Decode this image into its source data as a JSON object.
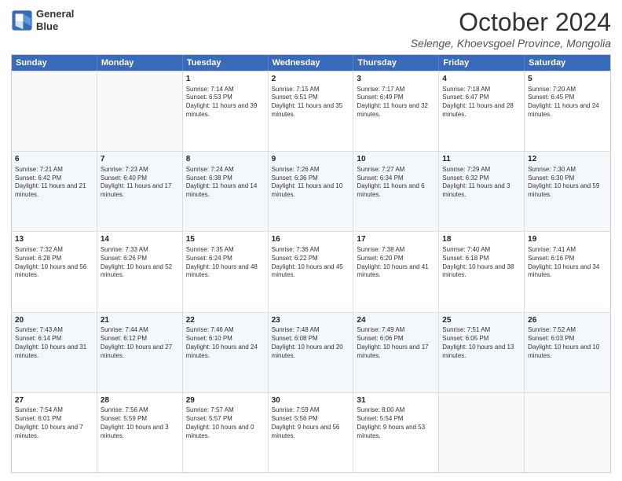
{
  "logo": {
    "line1": "General",
    "line2": "Blue"
  },
  "header": {
    "month": "October 2024",
    "location": "Selenge, Khoevsgoel Province, Mongolia"
  },
  "weekdays": [
    "Sunday",
    "Monday",
    "Tuesday",
    "Wednesday",
    "Thursday",
    "Friday",
    "Saturday"
  ],
  "rows": [
    [
      {
        "day": "",
        "info": ""
      },
      {
        "day": "",
        "info": ""
      },
      {
        "day": "1",
        "info": "Sunrise: 7:14 AM\nSunset: 6:53 PM\nDaylight: 11 hours and 39 minutes."
      },
      {
        "day": "2",
        "info": "Sunrise: 7:15 AM\nSunset: 6:51 PM\nDaylight: 11 hours and 35 minutes."
      },
      {
        "day": "3",
        "info": "Sunrise: 7:17 AM\nSunset: 6:49 PM\nDaylight: 11 hours and 32 minutes."
      },
      {
        "day": "4",
        "info": "Sunrise: 7:18 AM\nSunset: 6:47 PM\nDaylight: 11 hours and 28 minutes."
      },
      {
        "day": "5",
        "info": "Sunrise: 7:20 AM\nSunset: 6:45 PM\nDaylight: 11 hours and 24 minutes."
      }
    ],
    [
      {
        "day": "6",
        "info": "Sunrise: 7:21 AM\nSunset: 6:42 PM\nDaylight: 11 hours and 21 minutes."
      },
      {
        "day": "7",
        "info": "Sunrise: 7:23 AM\nSunset: 6:40 PM\nDaylight: 11 hours and 17 minutes."
      },
      {
        "day": "8",
        "info": "Sunrise: 7:24 AM\nSunset: 6:38 PM\nDaylight: 11 hours and 14 minutes."
      },
      {
        "day": "9",
        "info": "Sunrise: 7:26 AM\nSunset: 6:36 PM\nDaylight: 11 hours and 10 minutes."
      },
      {
        "day": "10",
        "info": "Sunrise: 7:27 AM\nSunset: 6:34 PM\nDaylight: 11 hours and 6 minutes."
      },
      {
        "day": "11",
        "info": "Sunrise: 7:29 AM\nSunset: 6:32 PM\nDaylight: 11 hours and 3 minutes."
      },
      {
        "day": "12",
        "info": "Sunrise: 7:30 AM\nSunset: 6:30 PM\nDaylight: 10 hours and 59 minutes."
      }
    ],
    [
      {
        "day": "13",
        "info": "Sunrise: 7:32 AM\nSunset: 6:28 PM\nDaylight: 10 hours and 56 minutes."
      },
      {
        "day": "14",
        "info": "Sunrise: 7:33 AM\nSunset: 6:26 PM\nDaylight: 10 hours and 52 minutes."
      },
      {
        "day": "15",
        "info": "Sunrise: 7:35 AM\nSunset: 6:24 PM\nDaylight: 10 hours and 48 minutes."
      },
      {
        "day": "16",
        "info": "Sunrise: 7:36 AM\nSunset: 6:22 PM\nDaylight: 10 hours and 45 minutes."
      },
      {
        "day": "17",
        "info": "Sunrise: 7:38 AM\nSunset: 6:20 PM\nDaylight: 10 hours and 41 minutes."
      },
      {
        "day": "18",
        "info": "Sunrise: 7:40 AM\nSunset: 6:18 PM\nDaylight: 10 hours and 38 minutes."
      },
      {
        "day": "19",
        "info": "Sunrise: 7:41 AM\nSunset: 6:16 PM\nDaylight: 10 hours and 34 minutes."
      }
    ],
    [
      {
        "day": "20",
        "info": "Sunrise: 7:43 AM\nSunset: 6:14 PM\nDaylight: 10 hours and 31 minutes."
      },
      {
        "day": "21",
        "info": "Sunrise: 7:44 AM\nSunset: 6:12 PM\nDaylight: 10 hours and 27 minutes."
      },
      {
        "day": "22",
        "info": "Sunrise: 7:46 AM\nSunset: 6:10 PM\nDaylight: 10 hours and 24 minutes."
      },
      {
        "day": "23",
        "info": "Sunrise: 7:48 AM\nSunset: 6:08 PM\nDaylight: 10 hours and 20 minutes."
      },
      {
        "day": "24",
        "info": "Sunrise: 7:49 AM\nSunset: 6:06 PM\nDaylight: 10 hours and 17 minutes."
      },
      {
        "day": "25",
        "info": "Sunrise: 7:51 AM\nSunset: 6:05 PM\nDaylight: 10 hours and 13 minutes."
      },
      {
        "day": "26",
        "info": "Sunrise: 7:52 AM\nSunset: 6:03 PM\nDaylight: 10 hours and 10 minutes."
      }
    ],
    [
      {
        "day": "27",
        "info": "Sunrise: 7:54 AM\nSunset: 6:01 PM\nDaylight: 10 hours and 7 minutes."
      },
      {
        "day": "28",
        "info": "Sunrise: 7:56 AM\nSunset: 5:59 PM\nDaylight: 10 hours and 3 minutes."
      },
      {
        "day": "29",
        "info": "Sunrise: 7:57 AM\nSunset: 5:57 PM\nDaylight: 10 hours and 0 minutes."
      },
      {
        "day": "30",
        "info": "Sunrise: 7:59 AM\nSunset: 5:56 PM\nDaylight: 9 hours and 56 minutes."
      },
      {
        "day": "31",
        "info": "Sunrise: 8:00 AM\nSunset: 5:54 PM\nDaylight: 9 hours and 53 minutes."
      },
      {
        "day": "",
        "info": ""
      },
      {
        "day": "",
        "info": ""
      }
    ]
  ]
}
